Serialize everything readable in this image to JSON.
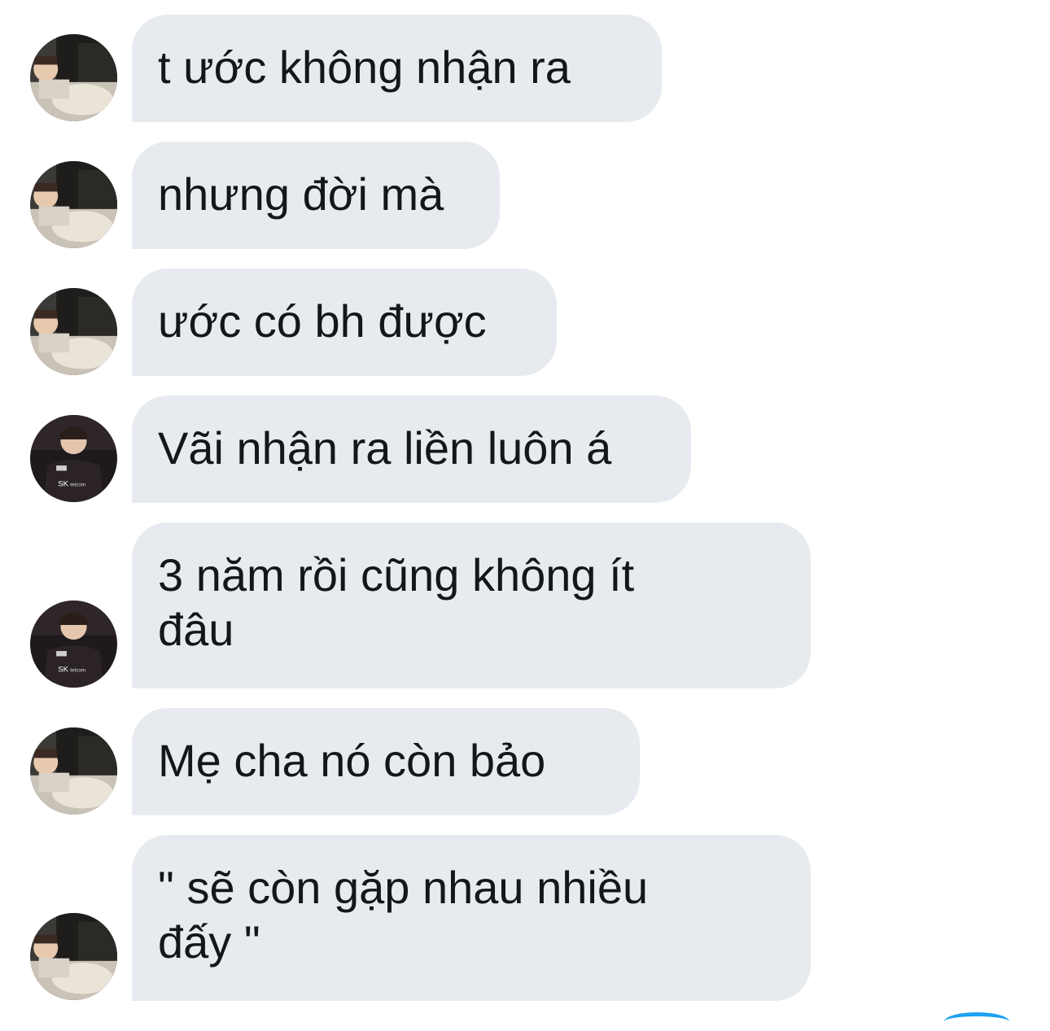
{
  "messages": [
    {
      "text": "t ước không nhận ra",
      "avatar": "avatar-couch-icon"
    },
    {
      "text": "nhưng đời mà",
      "avatar": "avatar-couch-icon"
    },
    {
      "text": "ước có bh được",
      "avatar": "avatar-couch-icon"
    },
    {
      "text": "Vãi nhận ra liền luôn á",
      "avatar": "avatar-jersey-icon"
    },
    {
      "text": "3 năm rồi cũng không ít\nđâu",
      "avatar": "avatar-jersey-icon"
    },
    {
      "text": "Mẹ cha nó còn bảo",
      "avatar": "avatar-couch-icon"
    },
    {
      "text": "\" sẽ còn gặp nhau nhiều\nđấy \"",
      "avatar": "avatar-couch-icon"
    }
  ],
  "colors": {
    "bubble_bg": "#e7ebef",
    "text": "#14171a",
    "accent": "#1da1f2"
  }
}
